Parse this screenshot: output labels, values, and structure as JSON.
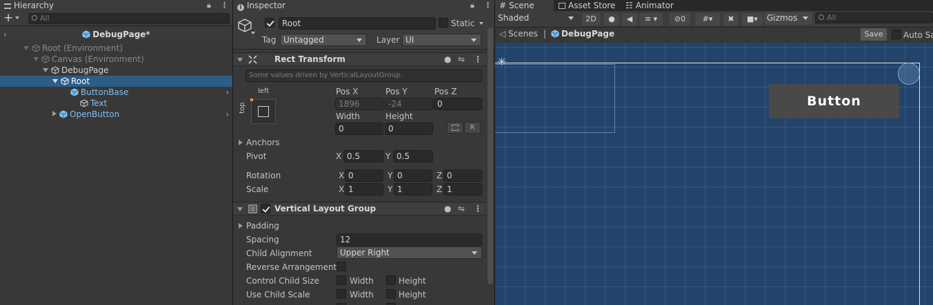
{
  "hierarchy": {
    "tab_label": "Hierarchy",
    "search_placeholder": "All",
    "scene_title": "DebugPage*",
    "rows": [
      {
        "label": "Root (Environment)"
      },
      {
        "label": "Canvas (Environment)"
      },
      {
        "label": "DebugPage"
      },
      {
        "label": "Root"
      },
      {
        "label": "ButtonBase"
      },
      {
        "label": "Text"
      },
      {
        "label": "OpenButton"
      }
    ]
  },
  "inspector": {
    "tab_label": "Inspector",
    "object_name": "Root",
    "static_label": "Static",
    "tag_label": "Tag",
    "tag_value": "Untagged",
    "layer_label": "Layer",
    "layer_value": "UI",
    "rect_transform": {
      "title": "Rect Transform",
      "driven_note": "Some values driven by VerticalLayoutGroup.",
      "anchor_h": "left",
      "anchor_v": "top",
      "pos_x_label": "Pos X",
      "pos_x": "1896",
      "pos_y_label": "Pos Y",
      "pos_y": "-24",
      "pos_z_label": "Pos Z",
      "pos_z": "0",
      "width_label": "Width",
      "width": "0",
      "height_label": "Height",
      "height": "0",
      "r_button": "R",
      "anchors_label": "Anchors",
      "pivot_label": "Pivot",
      "pivot_x": "0.5",
      "pivot_y": "0.5",
      "rotation_label": "Rotation",
      "rot_x": "0",
      "rot_y": "0",
      "rot_z": "0",
      "scale_label": "Scale",
      "scale_x": "1",
      "scale_y": "1",
      "scale_z": "1",
      "axis_x": "X",
      "axis_y": "Y",
      "axis_z": "Z"
    },
    "vertical_layout": {
      "title": "Vertical Layout Group",
      "padding_label": "Padding",
      "spacing_label": "Spacing",
      "spacing": "12",
      "child_alignment_label": "Child Alignment",
      "child_alignment": "Upper Right",
      "reverse_label": "Reverse Arrangement",
      "control_size_label": "Control Child Size",
      "use_scale_label": "Use Child Scale",
      "width_label": "Width",
      "height_label": "Height"
    }
  },
  "scene": {
    "tabs": [
      "Scene",
      "Asset Store",
      "Animator"
    ],
    "shading": "Shaded",
    "mode_2d": "2D",
    "hidden_count": "0",
    "gizmos": "Gizmos",
    "search_placeholder": "All",
    "breadcrumb_root": "Scenes",
    "breadcrumb_current": "DebugPage",
    "save_label": "Save",
    "auto_save_label": "Auto Save",
    "button_text": "Button"
  },
  "colors": {
    "selection": "#2c5d87",
    "prefab_blue": "#7fc0f5",
    "viewport_bg": "#22436a"
  }
}
